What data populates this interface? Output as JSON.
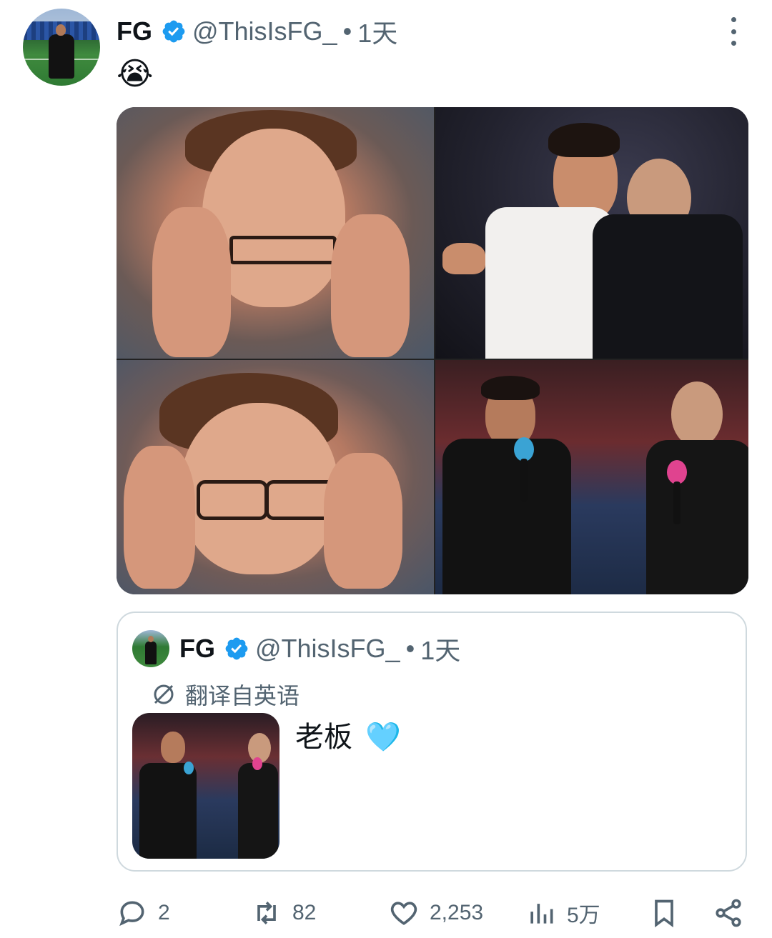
{
  "tweet": {
    "author_name": "FG",
    "handle": "@ThisIsFG_",
    "separator": "•",
    "time": "1天",
    "text": "😭",
    "verified": true
  },
  "quoted_tweet": {
    "author_name": "FG",
    "handle": "@ThisIsFG_",
    "separator": "•",
    "time": "1天",
    "translate_label": "翻译自英语",
    "text": "老板",
    "text_emoji": "🩵"
  },
  "actions": {
    "reply_count": "2",
    "retweet_count": "82",
    "like_count": "2,253",
    "view_count": "5万"
  },
  "colors": {
    "verified": "#1d9bf0",
    "secondary_text": "#536471",
    "border": "#cfd9de"
  }
}
